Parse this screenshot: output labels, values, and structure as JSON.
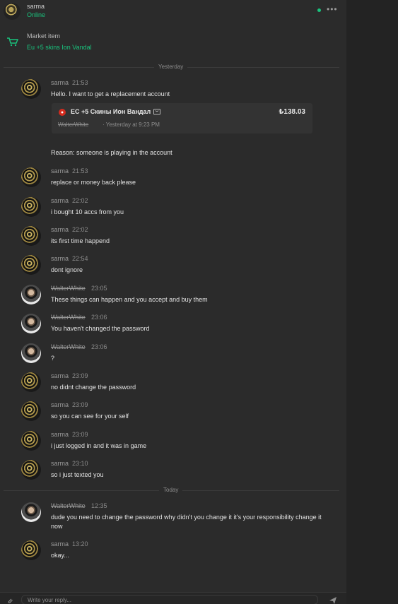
{
  "header": {
    "name": "sarma",
    "status": "Online",
    "more_label": "•••"
  },
  "market": {
    "title": "Market item",
    "item": "Eu +5 skins Ion Vandal"
  },
  "dividers": {
    "yesterday": "Yesterday",
    "today": "Today"
  },
  "card": {
    "title": "ЕС +5 Скины Ион Вандал",
    "price": "₺138.03",
    "seller": "WalterWhite",
    "date": "· Yesterday at 9:23 PM"
  },
  "reason": "Reason: someone is playing in the account",
  "messages": [
    {
      "author": "sarma",
      "time": "21:53",
      "text": "Hello. I want to get a replacement account"
    },
    {
      "author": "sarma",
      "time": "21:53",
      "text": "replace or money back please"
    },
    {
      "author": "sarma",
      "time": "22:02",
      "text": "i bought 10 accs from you"
    },
    {
      "author": "sarma",
      "time": "22:02",
      "text": "its first time happend"
    },
    {
      "author": "sarma",
      "time": "22:54",
      "text": "dont ignore"
    },
    {
      "author": "WalterWhite",
      "time": "23:05",
      "text": "These things can happen and you accept and buy them"
    },
    {
      "author": "WalterWhite",
      "time": "23:06",
      "text": "You haven't changed the password"
    },
    {
      "author": "WalterWhite",
      "time": "23:06",
      "text": "?"
    },
    {
      "author": "sarma",
      "time": "23:09",
      "text": "no didnt change the password"
    },
    {
      "author": "sarma",
      "time": "23:09",
      "text": "so you can see for your self"
    },
    {
      "author": "sarma",
      "time": "23:09",
      "text": "i just logged in and it was in game"
    },
    {
      "author": "sarma",
      "time": "23:10",
      "text": "so i just texted you"
    },
    {
      "author": "WalterWhite",
      "time": "12:35",
      "text": "dude you need to change the password why didn't you change it it's your responsibility change it now"
    },
    {
      "author": "sarma",
      "time": "13:20",
      "text": "okay..."
    }
  ],
  "composer": {
    "placeholder": "Write your reply..."
  },
  "colors": {
    "accent": "#19c37d",
    "background": "#2b2b2b"
  }
}
